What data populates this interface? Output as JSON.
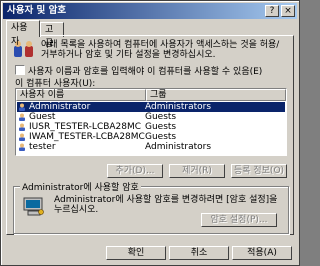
{
  "window": {
    "title": "사용자 및 암호",
    "help_glyph": "?",
    "close_glyph": "×"
  },
  "tabs": [
    {
      "label": "사용자"
    },
    {
      "label": "고급"
    }
  ],
  "intro_text": "아래 목록을 사용하여 컴퓨터에 사용자가 액세스하는 것을 허용/거부하거나 암호 및 기타 설정을 변경하십시오.",
  "require_login_checkbox": {
    "label": "사용자 이름과 암호를 입력해야 이 컴퓨터를 사용할 수 있음(E)",
    "checked": false
  },
  "users_label": "이 컴퓨터 사용자(U):",
  "users_table": {
    "columns": [
      "사용자 이름",
      "그룹"
    ],
    "rows": [
      {
        "name": "Administrator",
        "group": "Administrators",
        "selected": true
      },
      {
        "name": "Guest",
        "group": "Guests",
        "selected": false
      },
      {
        "name": "IUSR_TESTER-LCBA28MC",
        "group": "Guests",
        "selected": false
      },
      {
        "name": "IWAM_TESTER-LCBA28MC",
        "group": "Guests",
        "selected": false
      },
      {
        "name": "tester",
        "group": "Administrators",
        "selected": false
      }
    ]
  },
  "list_buttons": {
    "add": "추가(D)...",
    "remove": "제거(R)",
    "properties": "등록 정보(O)"
  },
  "password_group": {
    "legend": "Administrator에 사용할 암호",
    "text": "Administrator에 사용할 암호를 변경하려면 [암호 설정]을 누르십시오.",
    "set_password_button": "암호 설정(P)..."
  },
  "footer": {
    "ok": "확인",
    "cancel": "취소",
    "apply": "적용(A)"
  }
}
